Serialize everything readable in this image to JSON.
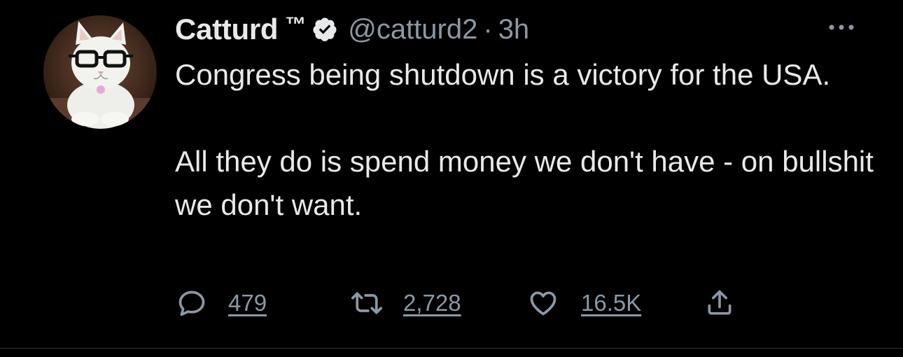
{
  "tweet": {
    "author": {
      "display_name": "Catturd",
      "name_suffix": "™",
      "handle": "@catturd2",
      "verified": true,
      "avatar_icon": "cat-with-glasses-avatar"
    },
    "separator": "·",
    "time": "3h",
    "body": [
      "Congress being shutdown is a victory for the USA.",
      "All they do is spend money we don't have - on bullshit we don't want."
    ],
    "actions": {
      "replies": "479",
      "retweets": "2,728",
      "likes": "16.5K"
    },
    "icons": {
      "verified": "verified-badge-icon",
      "more": "more-options-icon",
      "reply": "reply-icon",
      "retweet": "retweet-icon",
      "like": "heart-icon",
      "share": "share-icon"
    },
    "colors": {
      "background": "#000000",
      "text": "#e7e9ea",
      "secondary": "#8b98a5"
    }
  }
}
